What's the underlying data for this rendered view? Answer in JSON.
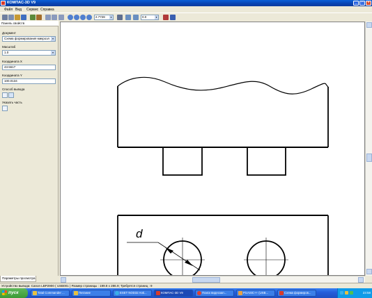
{
  "window": {
    "title": "КОМПАС-3D V9"
  },
  "menu": [
    "Файл",
    "Вид",
    "Сервис",
    "Справка"
  ],
  "toolbar": {
    "zoom_value": "2.7728",
    "angle_value": "0.0"
  },
  "panel": {
    "title": "Панель свойств",
    "document_label": "Документ",
    "document_value": "Схема формирования микроэл",
    "scale_label": "Масштаб",
    "scale_value": "1.0",
    "coord_x_label": "Координата X",
    "coord_x_value": "43.5617",
    "coord_y_label": "Координата Y",
    "coord_y_value": "100.0134",
    "output_label": "Способ вывода",
    "part_label": "Указать часть",
    "tab_label": "Параметры просмотра"
  },
  "drawing": {
    "annotation": "d"
  },
  "status": {
    "text": "Устройство вывода: Canon LBP2900 ( USB001 ) Размер страницы : 199.8 x 286.9; Требуется страниц : 9"
  },
  "taskbar": {
    "start": "пуск",
    "tasks": [
      "Total Commander ...",
      "Питание",
      "ESET NOD32 Anti...",
      "КОМПАС-3D V9",
      "Поиск видеозап...",
      "PicASIC++ (USB...",
      "Схема формиров..."
    ],
    "clock": "23:58"
  },
  "colors": {
    "title_blue": "#0842b0",
    "start_green": "#3c9a36",
    "taskbar_blue": "#245edb"
  }
}
